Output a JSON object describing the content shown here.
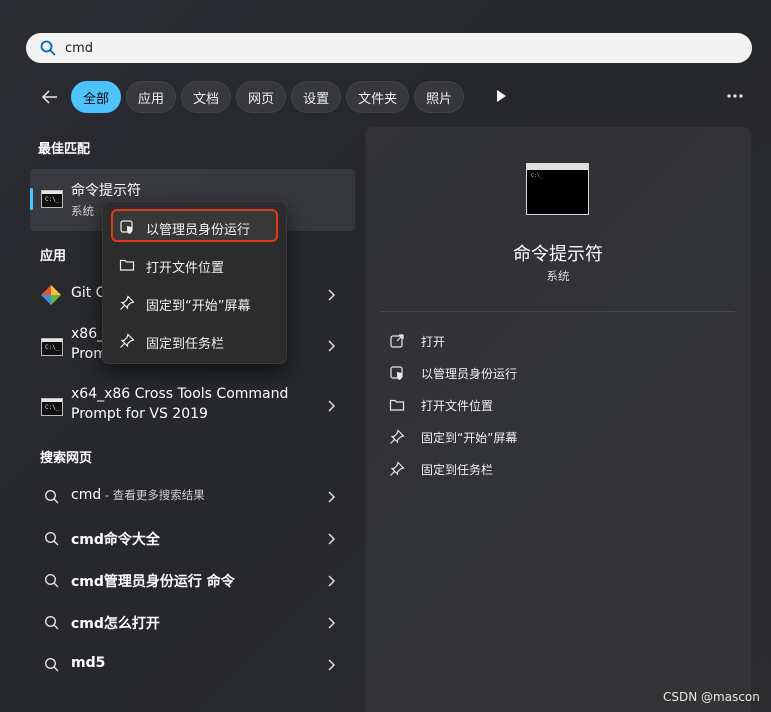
{
  "search": {
    "value": "cmd"
  },
  "tabs": [
    "全部",
    "应用",
    "文档",
    "网页",
    "设置",
    "文件夹",
    "照片"
  ],
  "colors": {
    "accent": "#4cc2ff",
    "highlight_border": "#e0391a"
  },
  "best_match": {
    "section_title": "最佳匹配",
    "title": "命令提示符",
    "subtitle": "系统"
  },
  "context_menu": {
    "items": [
      "以管理员身份运行",
      "打开文件位置",
      "固定到“开始”屏幕",
      "固定到任务栏"
    ]
  },
  "apps": {
    "section_title": "应用",
    "items": [
      {
        "line1": "Git C",
        "line2": "",
        "icon": "git-icon"
      },
      {
        "line1": "x86_",
        "line2": "Prom",
        "icon": "cmd-icon"
      },
      {
        "line1": "x64_x86 Cross Tools Command",
        "line2": "Prompt for VS 2019",
        "icon": "cmd-icon"
      }
    ]
  },
  "web": {
    "section_title": "搜索网页",
    "items": [
      {
        "text": "cmd",
        "suffix": " - 查看更多搜索结果"
      },
      {
        "text": "cmd命令大全",
        "suffix": ""
      },
      {
        "text": "cmd管理员身份运行 命令",
        "suffix": ""
      },
      {
        "text": "cmd怎么打开",
        "suffix": ""
      },
      {
        "text": "md5",
        "suffix": ""
      }
    ]
  },
  "right_panel": {
    "title": "命令提示符",
    "subtitle": "系统",
    "actions": [
      "打开",
      "以管理员身份运行",
      "打开文件位置",
      "固定到“开始”屏幕",
      "固定到任务栏"
    ]
  },
  "watermark": "CSDN @mascon"
}
